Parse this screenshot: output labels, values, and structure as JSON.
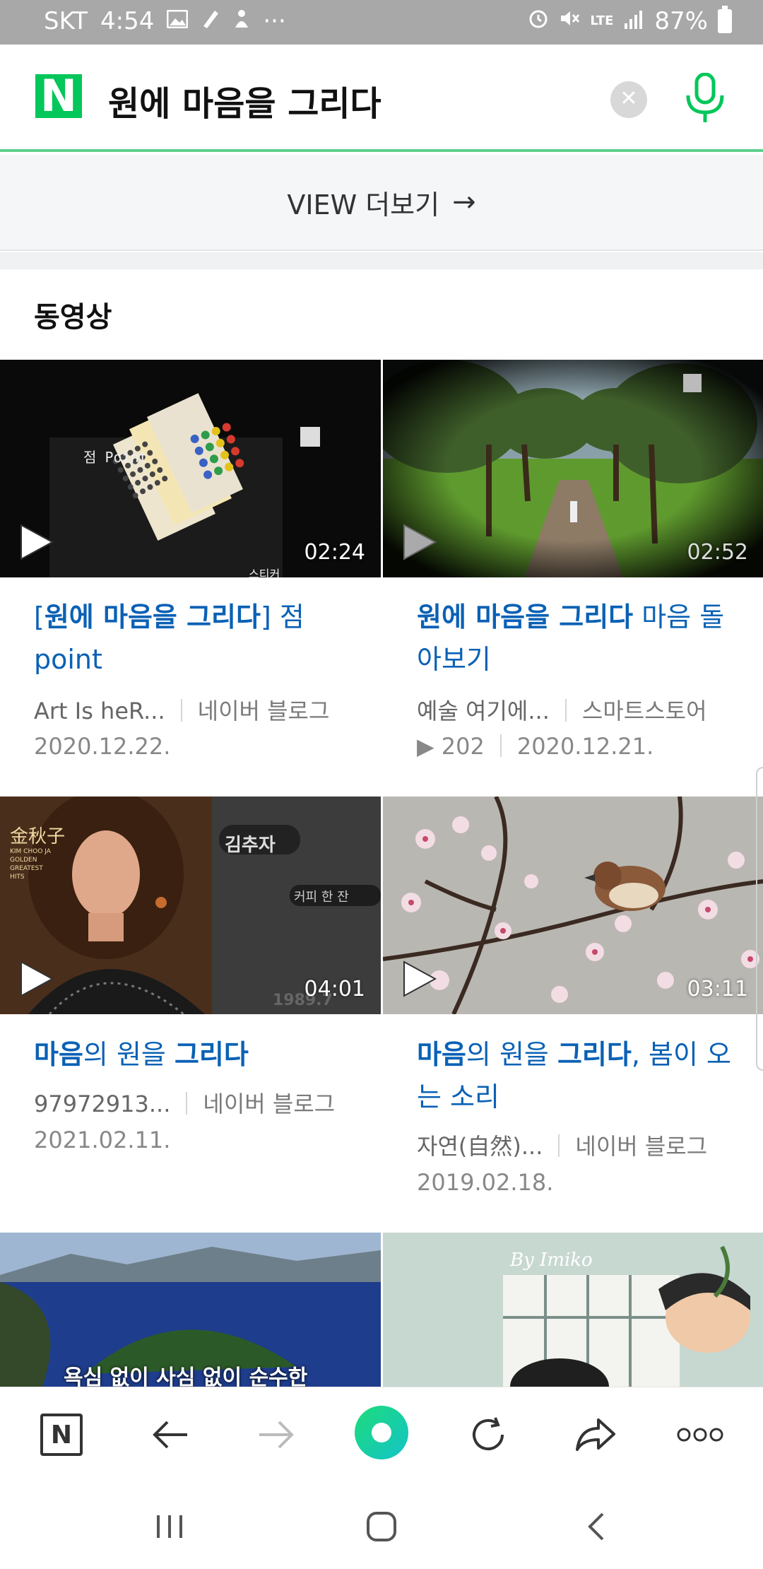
{
  "status_bar": {
    "carrier": "SKT",
    "time": "4:54",
    "more": "···",
    "network": "LTE",
    "battery": "87%"
  },
  "search": {
    "logo": "N",
    "query": "원에 마음을 그리다",
    "clear_icon": "close-icon",
    "mic_icon": "microphone-icon"
  },
  "view_more": {
    "label": "VIEW 더보기",
    "arrow": "→"
  },
  "videos": {
    "section_title": "동영상",
    "items": [
      {
        "title_parts": [
          "[",
          "원에 마음을 그리다",
          "] 점 point"
        ],
        "duration": "02:24",
        "author": "Art Is heR...",
        "source": "네이버 블로그",
        "views": "",
        "date": "2020.12.22.",
        "thumb_caption": "점 Point",
        "thumb_caption2": "스티커"
      },
      {
        "title_parts": [
          "",
          "원에 마음을 그리다",
          " 마음 돌아보기"
        ],
        "duration": "02:52",
        "author": "예술 여기에...",
        "source": "스마트스토어",
        "views": "202",
        "date": "2020.12.21."
      },
      {
        "title_parts": [
          "",
          "마음",
          "의 원을 ",
          "그리다"
        ],
        "duration": "04:01",
        "author": "97972913...",
        "source": "네이버 블로그",
        "views": "",
        "date": "2021.02.11.",
        "thumb_caption": "김추자",
        "thumb_caption2": "커피 한 잔",
        "thumb_caption3": "金秋子",
        "thumb_caption4": "KIM CHOO JA GOLDEN GREATEST HITS",
        "thumb_caption5": "1989.7"
      },
      {
        "title_parts": [
          "",
          "마음",
          "의 원을 ",
          "그리다",
          ", 봄이 오는 소리"
        ],
        "duration": "03:11",
        "author": "자연(自然)...",
        "source": "네이버 블로그",
        "views": "",
        "date": "2019.02.18."
      },
      {
        "thumb_caption": "욕심 없이 사심 없이 순수한"
      },
      {
        "thumb_caption": "By Imiko"
      }
    ]
  },
  "toolbar": {
    "home": "N"
  },
  "colors": {
    "naver_green": "#03c75a",
    "link_blue": "#0a61b5",
    "status_bar": "#a8a8a8"
  }
}
